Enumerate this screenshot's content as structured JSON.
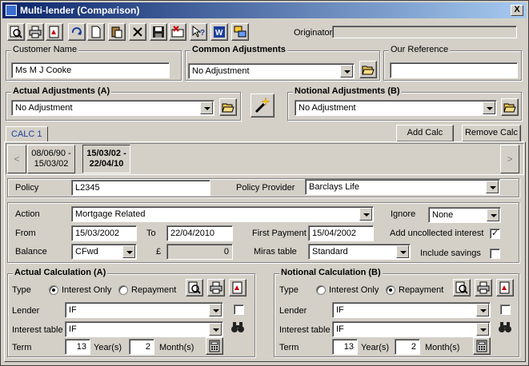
{
  "window": {
    "title": "Multi-lender (Comparison)",
    "close_label": "X"
  },
  "toolbar": {
    "buttons": [
      "preview-icon",
      "print-icon",
      "pdf-icon",
      "refresh-icon",
      "new-document-icon",
      "paste-icon",
      "delete-icon",
      "save-icon",
      "clear-icon",
      "help-icon",
      "word-icon",
      "window-icon"
    ],
    "originator_label": "Originator",
    "originator_value": ""
  },
  "customer": {
    "label": "Customer Name",
    "value": "Ms M J Cooke"
  },
  "common_adjustments": {
    "label": "Common Adjustments",
    "value": "No Adjustment"
  },
  "our_reference": {
    "label": "Our Reference",
    "value": ""
  },
  "actual_adjustments": {
    "label": "Actual Adjustments (A)",
    "value": "No Adjustment"
  },
  "notional_adjustments": {
    "label": "Notional Adjustments (B)",
    "value": "No Adjustment"
  },
  "tabs": [
    {
      "label": "CALC 1"
    }
  ],
  "add_calc_label": "Add Calc",
  "remove_calc_label": "Remove Calc",
  "periods": [
    {
      "line1": "08/06/90 -",
      "line2": "15/03/02"
    },
    {
      "line1": "15/03/02 -",
      "line2": "22/04/10"
    }
  ],
  "nav": {
    "prev": "<",
    "next": ">"
  },
  "policy": {
    "label": "Policy",
    "value": "L2345",
    "provider_label": "Policy Provider",
    "provider_value": "Barclays Life"
  },
  "details": {
    "action_label": "Action",
    "action_value": "Mortgage Related",
    "ignore_label": "Ignore",
    "ignore_value": "None",
    "from_label": "From",
    "from_value": "15/03/2002",
    "to_label": "To",
    "to_value": "22/04/2010",
    "first_payment_label": "First Payment",
    "first_payment_value": "15/04/2002",
    "add_uncollected_label": "Add uncollected interest",
    "add_uncollected_checked": true,
    "balance_label": "Balance",
    "balance_value": "CFwd",
    "currency_symbol": "£",
    "amount_value": "0",
    "miras_label": "Miras table",
    "miras_value": "Standard",
    "include_savings_label": "Include savings",
    "include_savings_checked": false
  },
  "actual_calc": {
    "title": "Actual Calculation (A)",
    "type_label": "Type",
    "interest_only_label": "Interest Only",
    "repayment_label": "Repayment",
    "selected_type": "interest_only",
    "lender_label": "Lender",
    "lender_value": "IF",
    "interest_table_label": "Interest table",
    "interest_table_value": "IF",
    "term_label": "Term",
    "years_value": "13",
    "years_label": "Year(s)",
    "months_value": "2",
    "months_label": "Month(s)"
  },
  "notional_calc": {
    "title": "Notional Calculation (B)",
    "type_label": "Type",
    "interest_only_label": "Interest Only",
    "repayment_label": "Repayment",
    "selected_type": "repayment",
    "lender_label": "Lender",
    "lender_value": "IF",
    "interest_table_label": "Interest table",
    "interest_table_value": "IF",
    "term_label": "Term",
    "years_value": "13",
    "years_label": "Year(s)",
    "months_value": "2",
    "months_label": "Month(s)"
  },
  "colors": {
    "titlebar_start": "#0a246a",
    "titlebar_end": "#a6caf0",
    "tab_text": "#1a3d9c",
    "face": "#d4d0c8"
  }
}
